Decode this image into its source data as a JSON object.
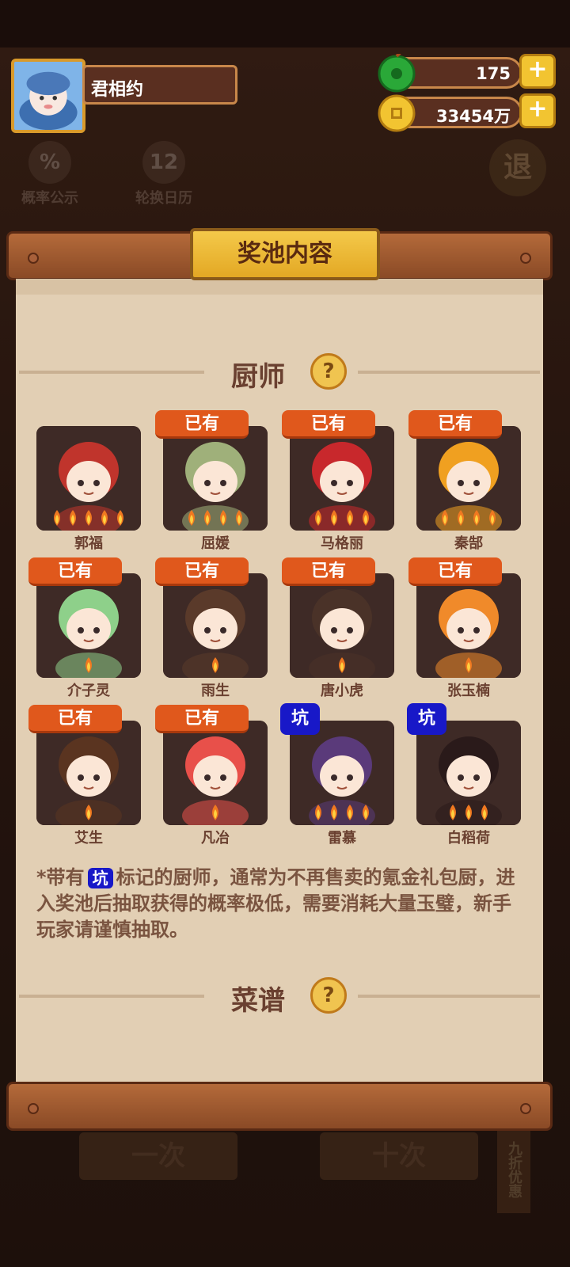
{
  "player": {
    "name": "君相约"
  },
  "resources": {
    "jade": "175",
    "coins": "33454万"
  },
  "background_menu": {
    "probability": "概率公示",
    "calendar": "轮换日历",
    "exit": "退",
    "single_draw": "一次",
    "ten_draw": "十次",
    "discount": "九折优惠"
  },
  "panel": {
    "title": "奖池内容",
    "chef_section": "厨师",
    "recipe_section": "菜谱",
    "help_symbol": "?",
    "owned_label": "已有",
    "pit_label": "坑",
    "note_prefix": "*带有",
    "note_suffix": "标记的厨师，通常为不再售卖的氪金礼包厨，进入奖池后抽取获得的概率极低，需要消耗大量玉璧，新手玩家请谨慎抽取。"
  },
  "chefs": [
    {
      "name": "郭福",
      "tag": "",
      "hair": "#c0342c",
      "stars": 5
    },
    {
      "name": "屈媛",
      "tag": "已有",
      "hair": "#9fb07a",
      "stars": 4
    },
    {
      "name": "马格丽",
      "tag": "已有",
      "hair": "#c8282c",
      "stars": 4
    },
    {
      "name": "秦郜",
      "tag": "已有",
      "hair": "#f0a020",
      "stars": 4
    },
    {
      "name": "介子灵",
      "tag": "已有",
      "hair": "#8ed08a",
      "stars": 1
    },
    {
      "name": "雨生",
      "tag": "已有",
      "hair": "#5a3a2a",
      "stars": 1
    },
    {
      "name": "唐小虎",
      "tag": "已有",
      "hair": "#4a3228",
      "stars": 1
    },
    {
      "name": "张玉楠",
      "tag": "已有",
      "hair": "#f08a2a",
      "stars": 1
    },
    {
      "name": "艾生",
      "tag": "已有",
      "hair": "#5a3420",
      "stars": 1
    },
    {
      "name": "凡冶",
      "tag": "已有",
      "hair": "#e8504a",
      "stars": 1
    },
    {
      "name": "雷慕",
      "tag": "坑",
      "hair": "#5a3a7a",
      "stars": 4
    },
    {
      "name": "白稻荷",
      "tag": "坑",
      "hair": "#2a1a1a",
      "stars": 3
    }
  ]
}
